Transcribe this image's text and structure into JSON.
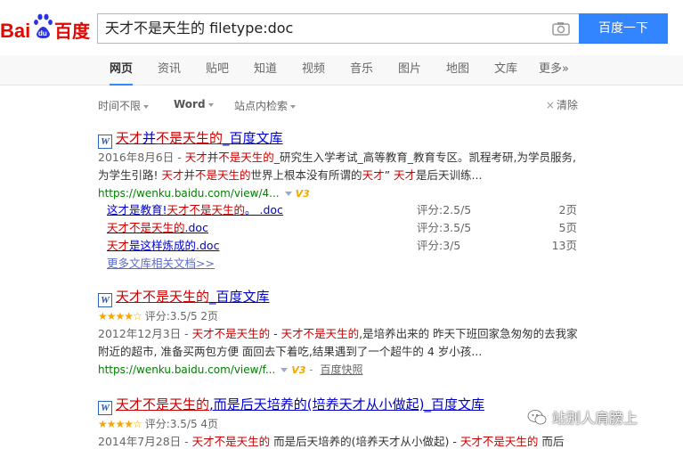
{
  "header": {
    "logo_text_left": "Bai",
    "logo_text_right": "百度",
    "logo_du": "du",
    "search_query": "天才不是天生的 filetype:doc",
    "search_button_label": "百度一下"
  },
  "tabs": [
    {
      "label": "网页",
      "active": true
    },
    {
      "label": "资讯"
    },
    {
      "label": "贴吧"
    },
    {
      "label": "知道"
    },
    {
      "label": "视频"
    },
    {
      "label": "音乐"
    },
    {
      "label": "图片"
    },
    {
      "label": "地图"
    },
    {
      "label": "文库"
    },
    {
      "label": "更多»"
    }
  ],
  "filters": {
    "time": "时间不限",
    "format": "Word",
    "site": "站点内检索",
    "clear": "清除"
  },
  "results": [
    {
      "title_parts": [
        "天才",
        "并",
        "不是天生的",
        "_百度文库"
      ],
      "abstract_date": "2016年8月6日 - ",
      "abstract_parts": [
        [
          "天才",
          "em"
        ],
        [
          "并",
          ""
        ],
        [
          "不是天生的",
          "em"
        ],
        [
          "_研究生入学考试_高等教育_教育专区。凯程考研,为学员服务,为学生引路! ",
          ""
        ],
        [
          "天才",
          "em"
        ],
        [
          "并",
          ""
        ],
        [
          "不是天生的",
          "em"
        ],
        [
          "世界上根本没有所谓的",
          ""
        ],
        [
          "天才",
          "em"
        ],
        [
          "” ",
          ""
        ],
        [
          "天才",
          "em"
        ],
        [
          "是后天训练...",
          ""
        ]
      ],
      "url": "https://wenku.baidu.com/view/4...",
      "badge": "V3",
      "docs": [
        {
          "name_parts": [
            [
              "这才是教育!",
              ""
            ],
            [
              "天才不是天生的",
              "em"
            ],
            [
              "。 .doc",
              ""
            ]
          ],
          "score": "评分:2.5/5",
          "pages": "2页"
        },
        {
          "name_parts": [
            [
              "天才不是天生的",
              "em"
            ],
            [
              ".doc",
              ""
            ]
          ],
          "score": "评分:3.5/5",
          "pages": "5页"
        },
        {
          "name_parts": [
            [
              "天才",
              "em"
            ],
            [
              "是这样炼成的.doc",
              ""
            ]
          ],
          "score": "评分:3/5",
          "pages": "13页"
        }
      ],
      "more_docs": "更多文库相关文档>>"
    },
    {
      "title_parts": [
        "天才不是天生的",
        "_百度文库"
      ],
      "stars": "★★★★☆",
      "rating": "评分:3.5/5 2页",
      "abstract_date": "2012年12月3日 - ",
      "abstract_parts": [
        [
          "天才不是天生的",
          "em"
        ],
        [
          " - ",
          ""
        ],
        [
          "天才不是天生的",
          "em"
        ],
        [
          ",是培养出来的 昨天下班回家急匆匆的去我家附近的超市, 准备买两包方便 面回去下着吃,结果遇到了一个超牛的 4 岁小孩...",
          ""
        ]
      ],
      "url": "https://wenku.baidu.com/view/f...",
      "badge": "V3",
      "snapshot": "百度快照"
    },
    {
      "title_parts": [
        "天才不是天生的",
        ",而是后天培养的(培养天才从小做起)_百度文库"
      ],
      "stars": "★★★★☆",
      "rating": "评分:3.5/5 4页",
      "abstract_date": "2014年7月28日 - ",
      "abstract_parts": [
        [
          "天才不是天生的",
          "em"
        ],
        [
          " 而是后天培养的(培养天才从小做起) - ",
          ""
        ],
        [
          "天才不是天生的",
          "em"
        ],
        [
          " 而后",
          ""
        ]
      ]
    }
  ],
  "watermark": "站别人肩膀上",
  "colors": {
    "brand_blue": "#3385ff",
    "link": "#0000cc",
    "highlight": "#cc0000",
    "url_green": "#008000",
    "star": "#f7a600"
  }
}
